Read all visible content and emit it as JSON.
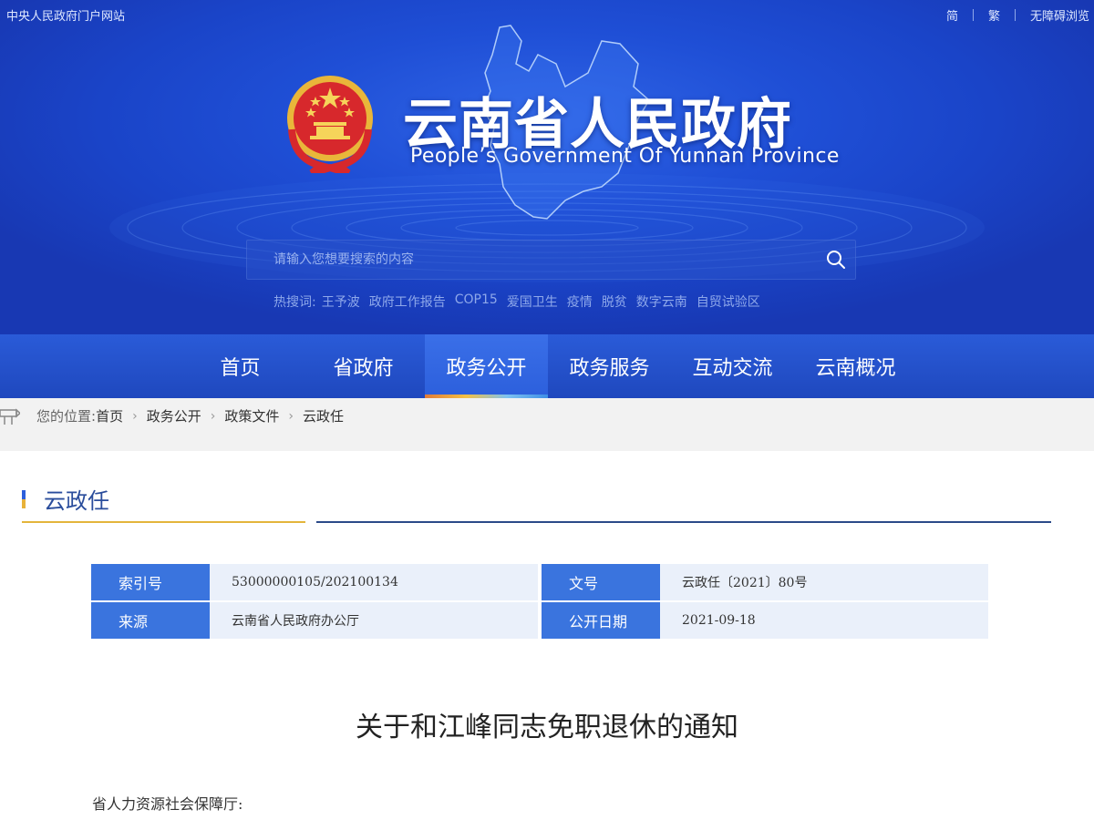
{
  "top_bar": {
    "left_link": "中央人民政府门户网站",
    "right_links": [
      "简",
      "繁",
      "无障碍浏览"
    ]
  },
  "header": {
    "title": "云南省人民政府",
    "subtitle": "People’s Government Of Yunnan Province",
    "emblem_icon": "national-emblem-icon"
  },
  "search": {
    "placeholder": "请输入您想要搜索的内容",
    "icon": "search-icon"
  },
  "hot_words": {
    "label": "热搜词:",
    "items": [
      "王予波",
      "政府工作报告",
      "COP15",
      "爱国卫生",
      "疫情",
      "脱贫",
      "数字云南",
      "自贸试验区"
    ]
  },
  "nav": {
    "items": [
      "首页",
      "省政府",
      "政务公开",
      "政务服务",
      "互动交流",
      "云南概况"
    ],
    "active_index": 2
  },
  "breadcrumb": {
    "label": "您的位置:",
    "items": [
      "首页",
      "政务公开",
      "政策文件",
      "云政任"
    ],
    "icon": "signpost-icon"
  },
  "section": {
    "title": "云政任"
  },
  "info": {
    "index_key": "索引号",
    "index_val": "53000000105/202100134",
    "doc_no_key": "文号",
    "doc_no_val": "云政任〔2021〕80号",
    "source_key": "来源",
    "source_val": "云南省人民政府办公厅",
    "date_key": "公开日期",
    "date_val": "2021-09-18"
  },
  "article": {
    "title": "关于和江峰同志免职退休的通知",
    "addressee": "省人力资源社会保障厅:"
  },
  "colors": {
    "banner_blue": "#1f4fd6",
    "nav_blue": "#2a5bd8",
    "key_blue": "#3a74de",
    "gold": "#e4b53b",
    "dark_blue": "#2b4a88"
  }
}
